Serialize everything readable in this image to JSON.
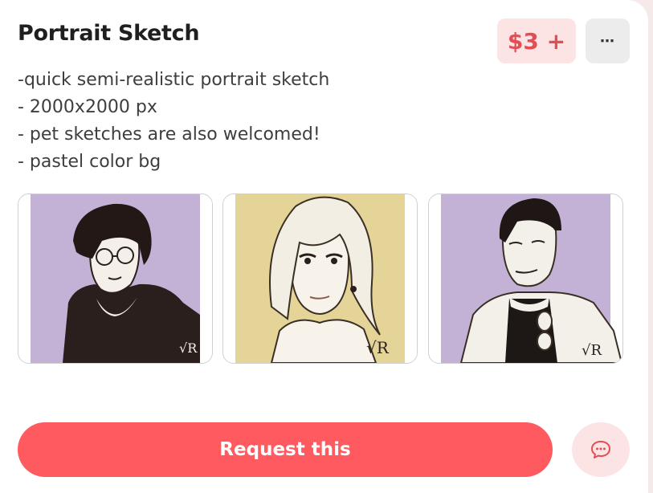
{
  "card": {
    "title": "Portrait Sketch",
    "price_label": "$3 +",
    "more_label": "⋯",
    "description": [
      "-quick semi-realistic portrait sketch",
      "- 2000x2000 px",
      "- pet sketches are also welcomed!",
      "- pastel color bg"
    ],
    "request_label": "Request this"
  },
  "colors": {
    "accent": "#ff5a5f",
    "price_text": "#e14f55",
    "price_bg": "#fde4e4",
    "thumb_bg_purple": "#c3b1d6",
    "thumb_bg_yellow": "#e5d498"
  },
  "icons": {
    "more": "ellipsis-icon",
    "chat": "chat-bubble-icon"
  }
}
